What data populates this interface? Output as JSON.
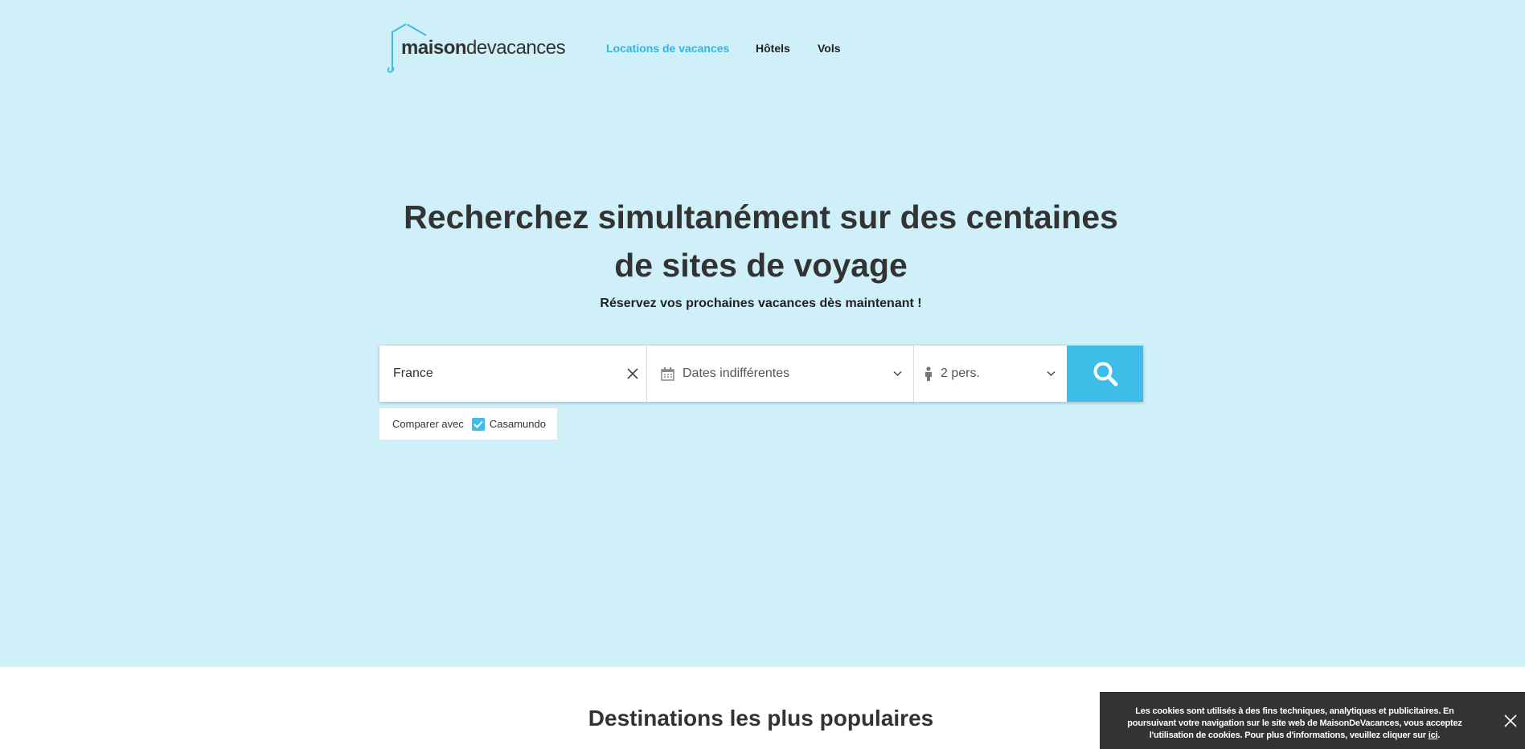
{
  "brand": {
    "logo_bold": "maison",
    "logo_light": "devacances",
    "accent_color": "#3dbde8"
  },
  "nav": {
    "items": [
      {
        "label": "Locations de vacances",
        "active": true
      },
      {
        "label": "Hôtels",
        "active": false
      },
      {
        "label": "Vols",
        "active": false
      }
    ]
  },
  "hero": {
    "title_line1": "Recherchez simultanément sur des centaines",
    "title_line2": "de sites de voyage",
    "subtitle": "Réservez vos prochaines vacances dès maintenant !"
  },
  "search": {
    "destination_value": "France",
    "dates_label": "Dates indifférentes",
    "persons_label": "2 pers."
  },
  "compare": {
    "label": "Comparer avec",
    "option_label": "Casamundo",
    "option_checked": true
  },
  "popular": {
    "title": "Destinations les plus populaires"
  },
  "cookie": {
    "text": "Les cookies sont utilisés à des fins techniques, analytiques et publicitaires. En poursuivant votre navigation sur le site web de MaisonDeVacances, vous acceptez l'utilisation de cookies. Pour plus d'informations, veuillez cliquer sur",
    "link_label": "ici",
    "end": "."
  }
}
